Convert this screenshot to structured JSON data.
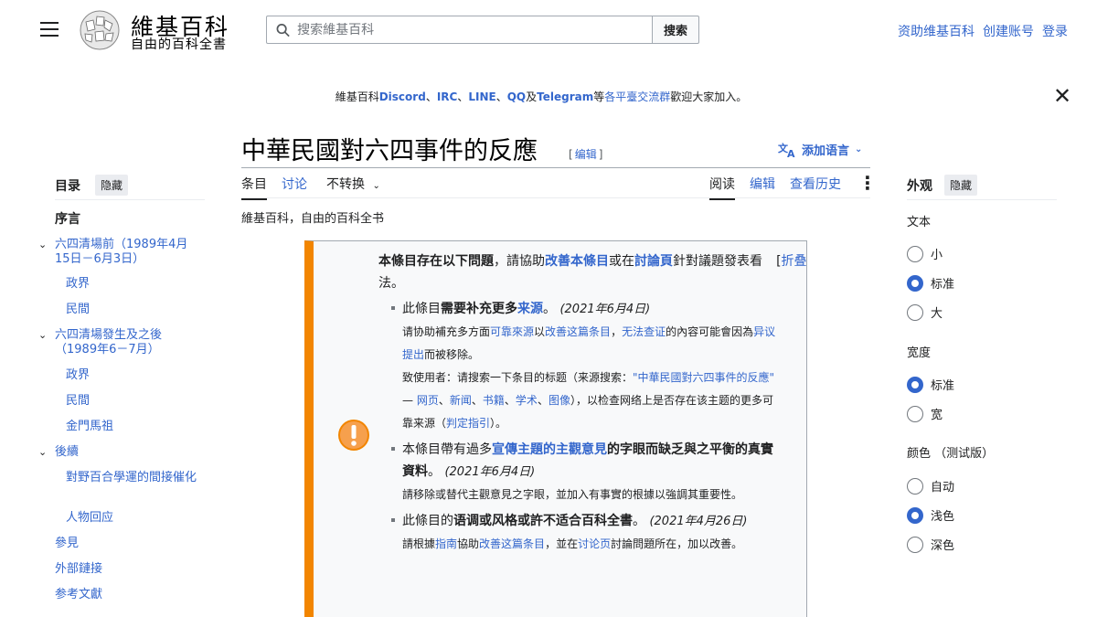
{
  "header": {
    "wordmark": "維基百科",
    "tagline": "自由的百科全書",
    "search_placeholder": "搜索維基百科",
    "search_button": "搜索",
    "user_links": [
      "资助维基百科",
      "创建账号",
      "登录"
    ]
  },
  "banner": {
    "parts": [
      {
        "t": "維基百科",
        "s": "plain"
      },
      {
        "t": "Discord",
        "s": "bold-link"
      },
      {
        "t": "、",
        "s": "plain"
      },
      {
        "t": "IRC",
        "s": "bold-link"
      },
      {
        "t": "、",
        "s": "plain"
      },
      {
        "t": "LINE",
        "s": "bold-link"
      },
      {
        "t": "、",
        "s": "plain"
      },
      {
        "t": "QQ",
        "s": "bold-link"
      },
      {
        "t": "及",
        "s": "plain"
      },
      {
        "t": "Telegram",
        "s": "bold-link"
      },
      {
        "t": "等",
        "s": "plain"
      },
      {
        "t": "各平臺交流群",
        "s": "link"
      },
      {
        "t": "歡迎大家加入。",
        "s": "plain"
      }
    ],
    "close_icon": "close-icon"
  },
  "page": {
    "title": "中華民國對六四事件的反應",
    "edit_link": "[编辑]",
    "add_languages": "添加语言",
    "from_wiki": "維基百科，自由的百科全书"
  },
  "tabs": {
    "left": [
      "条目",
      "讨论",
      "不转换"
    ],
    "right": [
      "阅读",
      "编辑",
      "查看历史"
    ]
  },
  "toc": {
    "heading": "目录",
    "hide": "隐藏",
    "items": [
      {
        "label": "序言",
        "level": 0,
        "bold": true,
        "chevron": false
      },
      {
        "label": "六四清場前（1989年4月15日－6月3日）",
        "level": 0,
        "chevron": true
      },
      {
        "label": "政界",
        "level": 1
      },
      {
        "label": "民間",
        "level": 1
      },
      {
        "label": "六四清場發生及之後（1989年6－7月）",
        "level": 0,
        "chevron": true
      },
      {
        "label": "政界",
        "level": 1
      },
      {
        "label": "民間",
        "level": 1
      },
      {
        "label": "金門馬祖",
        "level": 1
      },
      {
        "label": "後續",
        "level": 0,
        "chevron": true
      },
      {
        "label": "對野百合學運的間接催化",
        "level": 1
      },
      {
        "label": "人物回应",
        "level": 1
      },
      {
        "label": "參見",
        "level": 0
      },
      {
        "label": "外部鏈接",
        "level": 0
      },
      {
        "label": "参考文獻",
        "level": 0
      }
    ]
  },
  "appearance": {
    "heading": "外观",
    "hide": "隐藏",
    "text_label": "文本",
    "text_options": [
      {
        "label": "小",
        "on": false
      },
      {
        "label": "标准",
        "on": true
      },
      {
        "label": "大",
        "on": false
      }
    ],
    "width_label": "宽度",
    "width_options": [
      {
        "label": "标准",
        "on": true
      },
      {
        "label": "宽",
        "on": false
      }
    ],
    "color_label": "颜色 （测试版）",
    "color_options": [
      {
        "label": "自动",
        "on": false
      },
      {
        "label": "浅色",
        "on": true
      },
      {
        "label": "深色",
        "on": false
      }
    ]
  },
  "ambox": {
    "header_bold": "本條目存在以下問題",
    "header_mid": "，請協助",
    "header_link1": "改善本條目",
    "header_or": "或在",
    "header_link2": "討論頁",
    "header_tail": "針對議題發表看法。",
    "collapse": "折叠",
    "issue1": {
      "pre": "此條目",
      "bold": "需要补充更多",
      "link": "来源",
      "post": "。",
      "date": "(2021年6月4日)",
      "l1_a": "请协助補充多方面",
      "l1_b": "可靠來源",
      "l1_c": "以",
      "l1_d": "改善这篇条目",
      "l1_e": "，",
      "l1_f": "无法查证",
      "l1_g": "的內容可能會因為",
      "l1_h": "异议提出",
      "l1_i": "而被移除。",
      "l2_a": "致使用者：请搜索一下条目的标题（来源搜索：",
      "l2_b": "\"中華民國對六四事件的反應\"",
      "l2_c": " — ",
      "l2_d": "网页",
      "l2_e": "、",
      "l2_f": "新闻",
      "l2_g": "、",
      "l2_h": "书籍",
      "l2_i": "、",
      "l2_j": "学术",
      "l2_k": "、",
      "l2_l": "图像",
      "l2_m": "），以检查网络上是否存在该主题的更多可靠来源（",
      "l2_n": "判定指引",
      "l2_o": "）。"
    },
    "issue2": {
      "pre": "本條目帶有過多",
      "link": "宣傳主題的主觀意見",
      "bold": "的字眼而缺乏與之平衡的真實資料",
      "post": "。",
      "date": "(2021年6月4日)",
      "sub": "請移除或替代主觀意見之字眼，並加入有事實的根據以強調其重要性。"
    },
    "issue3": {
      "pre": "此條目的",
      "bold": "语调或风格或許不适合百科全書",
      "post": "。",
      "date": "(2021年4月26日)",
      "sub_a": "請根據",
      "sub_b": "指南",
      "sub_c": "協助",
      "sub_d": "改善这篇条目",
      "sub_e": "，並在",
      "sub_f": "讨论页",
      "sub_g": "討論問題所在，加以改善。"
    }
  }
}
